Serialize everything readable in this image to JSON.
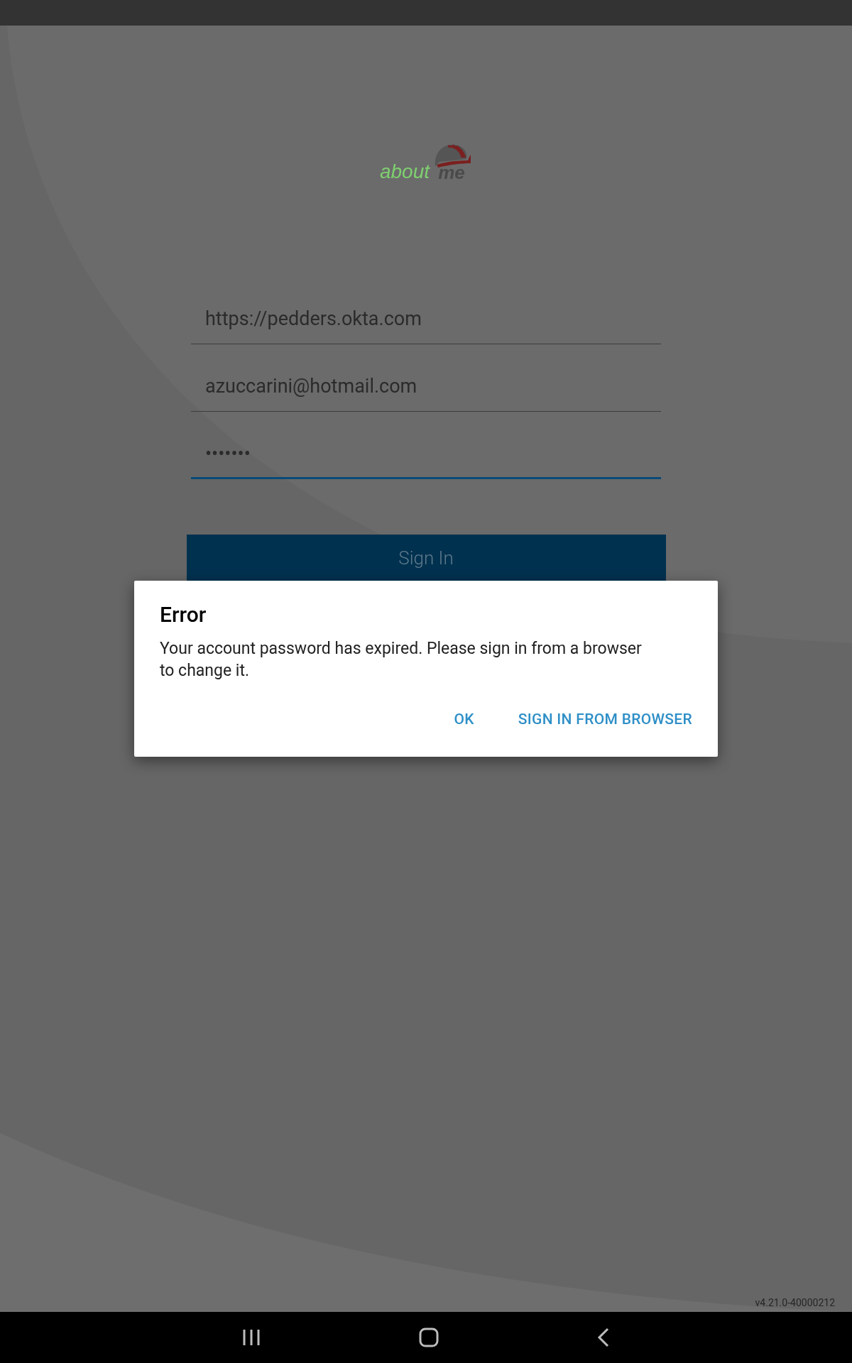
{
  "logo": {
    "word_1": "about",
    "word_2": "me"
  },
  "fields": [
    {
      "value": "https://pedders.okta.com",
      "focused": false
    },
    {
      "value": "azuccarini@hotmail.com",
      "focused": false
    },
    {
      "value": "•••••••",
      "focused": true
    }
  ],
  "sign_in_button": "Sign In",
  "dialog": {
    "title": "Error",
    "message": "Your account password has expired. Please sign in from a browser to change it.",
    "buttons": [
      "OK",
      "SIGN IN FROM BROWSER"
    ]
  },
  "version": "v4.21.0-40000212"
}
